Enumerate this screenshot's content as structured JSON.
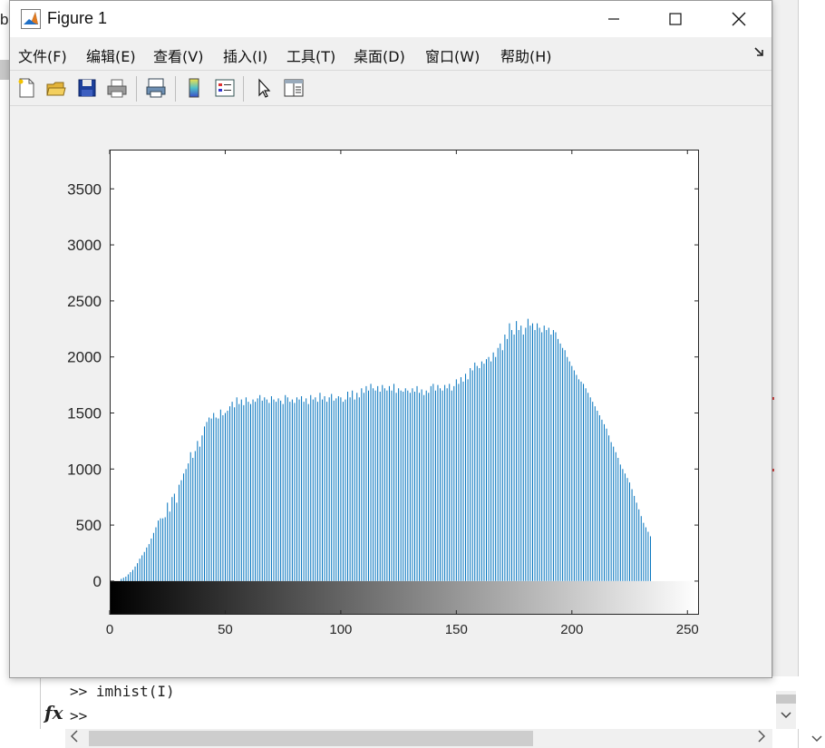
{
  "desktop": {
    "left_partial_text": "b",
    "command_lines": [
      ">> imhist(I)",
      ">>"
    ],
    "fx_label": "fx"
  },
  "figure": {
    "title": "Figure 1",
    "menu": [
      "文件(F)",
      "编辑(E)",
      "查看(V)",
      "插入(I)",
      "工具(T)",
      "桌面(D)",
      "窗口(W)",
      "帮助(H)"
    ],
    "toolbar_icons": [
      "new-figure-icon",
      "open-file-icon",
      "save-icon",
      "print-icon",
      "print-preview-icon",
      "colorbar-icon",
      "legend-icon",
      "edit-plot-arrow-icon",
      "property-inspector-icon"
    ]
  },
  "colors": {
    "bar": "#0072bd",
    "axes_bg": "#ffffff",
    "figure_bg": "#f0f0f0"
  },
  "chart_data": {
    "type": "bar",
    "title": "",
    "xlabel": "",
    "ylabel": "",
    "xlim": [
      0,
      255
    ],
    "ylim": [
      -300,
      3850
    ],
    "xticks": [
      0,
      50,
      100,
      150,
      200,
      250
    ],
    "yticks": [
      0,
      500,
      1000,
      1500,
      2000,
      2500,
      3000,
      3500
    ],
    "grid": false,
    "colorbar": "grayscale 0-255 below axis",
    "x_start": 0,
    "values": [
      0,
      0,
      0,
      0,
      0,
      20,
      30,
      40,
      60,
      80,
      100,
      130,
      160,
      200,
      230,
      260,
      300,
      330,
      380,
      430,
      480,
      540,
      560,
      560,
      570,
      700,
      620,
      750,
      780,
      700,
      860,
      900,
      960,
      1000,
      1050,
      1150,
      1100,
      1160,
      1250,
      1200,
      1300,
      1380,
      1420,
      1460,
      1450,
      1500,
      1460,
      1450,
      1530,
      1480,
      1500,
      1520,
      1560,
      1600,
      1550,
      1640,
      1580,
      1620,
      1570,
      1640,
      1600,
      1580,
      1620,
      1600,
      1630,
      1660,
      1610,
      1640,
      1620,
      1590,
      1650,
      1620,
      1600,
      1630,
      1610,
      1580,
      1660,
      1640,
      1600,
      1620,
      1590,
      1640,
      1620,
      1650,
      1600,
      1630,
      1580,
      1660,
      1620,
      1640,
      1600,
      1680,
      1620,
      1650,
      1600,
      1640,
      1670,
      1610,
      1630,
      1650,
      1640,
      1600,
      1620,
      1690,
      1640,
      1700,
      1620,
      1680,
      1640,
      1720,
      1680,
      1740,
      1700,
      1760,
      1720,
      1700,
      1740,
      1690,
      1750,
      1720,
      1700,
      1740,
      1700,
      1760,
      1680,
      1720,
      1700,
      1690,
      1720,
      1700,
      1680,
      1720,
      1690,
      1740,
      1680,
      1710,
      1660,
      1700,
      1680,
      1740,
      1760,
      1700,
      1750,
      1720,
      1700,
      1750,
      1720,
      1760,
      1700,
      1740,
      1800,
      1760,
      1820,
      1780,
      1850,
      1800,
      1900,
      1880,
      1950,
      1920,
      1900,
      1960,
      1940,
      1980,
      2000,
      1960,
      2040,
      2000,
      2080,
      2120,
      2060,
      2200,
      2160,
      2300,
      2240,
      2200,
      2320,
      2240,
      2280,
      2200,
      2260,
      2340,
      2280,
      2300,
      2240,
      2300,
      2260,
      2220,
      2280,
      2240,
      2260,
      2200,
      2240,
      2220,
      2160,
      2120,
      2080,
      2060,
      2000,
      1960,
      1920,
      1880,
      1840,
      1800,
      1780,
      1760,
      1720,
      1680,
      1640,
      1600,
      1560,
      1520,
      1480,
      1440,
      1400,
      1360,
      1300,
      1240,
      1200,
      1150,
      1100,
      1040,
      1000,
      960,
      920,
      880,
      820,
      760,
      700,
      640,
      580,
      520,
      480,
      440,
      400
    ]
  }
}
